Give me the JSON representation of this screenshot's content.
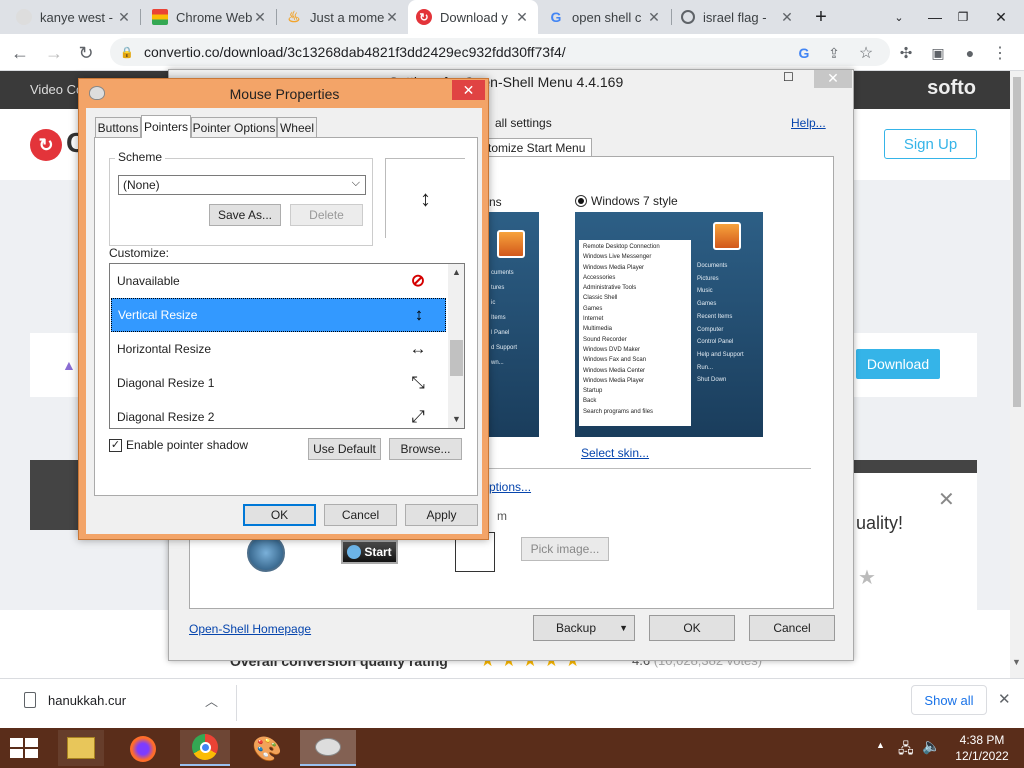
{
  "browser": {
    "tabs": [
      {
        "title": "kanye west -",
        "icon": "kanye-favicon-icon"
      },
      {
        "title": "Chrome Web",
        "icon": "chrome-web-store-icon"
      },
      {
        "title": "Just a mome",
        "icon": "cloudflare-flame-icon"
      },
      {
        "title": "Download y",
        "icon": "convertio-icon",
        "active": true
      },
      {
        "title": "open shell c",
        "icon": "google-g-icon"
      },
      {
        "title": "israel flag -",
        "icon": "globe-icon"
      }
    ],
    "url": "convertio.co/download/3c13268dab4821f3dd2429ec932fdd30ff73f4/"
  },
  "site": {
    "topbar_left": "Video Co",
    "topbar_brand": "softo",
    "logo_letter": "C",
    "signup": "Sign Up",
    "download": "Download",
    "promo_text": "uality!",
    "rating_label": "Overall conversion quality rating",
    "rating_value": "4.6",
    "rating_votes": "(10,028,382 votes)"
  },
  "openshell": {
    "title": "Settings for Open-Shell Menu 4.4.169",
    "all_settings": "all settings",
    "help": "Help...",
    "tab_label": "stomize Start Menu",
    "style_partial": "ns",
    "win7_label": "Windows 7 style",
    "select_skin": "Select skin...",
    "options_link": "ptions...",
    "m_label": "m",
    "start_label": "Start",
    "pick_image": "Pick image...",
    "homepage": "Open-Shell Homepage",
    "backup": "Backup",
    "ok": "OK",
    "cancel": "Cancel",
    "menu_items": [
      "Remote Desktop Connection",
      "Windows Live Messenger",
      "Windows Media Player",
      "Accessories",
      "Administrative Tools",
      "Classic Shell",
      "Games",
      "Internet",
      "Multimedia",
      "Sound Recorder",
      "Windows DVD Maker",
      "Windows Fax and Scan",
      "Windows Media Center",
      "Windows Media Player",
      "Startup",
      "Back",
      "Search programs and files"
    ],
    "right_items": [
      "Documents",
      "Pictures",
      "Music",
      "Games",
      "Recent Items",
      "Computer",
      "Control Panel",
      "Help and Support",
      "Run...",
      "Shut Down"
    ],
    "left_items": [
      "cuments",
      "tures",
      "ic",
      "Items",
      "l Panel",
      "d Support",
      "wn..."
    ]
  },
  "mouse": {
    "title": "Mouse Properties",
    "tabs": [
      "Buttons",
      "Pointers",
      "Pointer Options",
      "Wheel"
    ],
    "scheme_label": "Scheme",
    "scheme_value": "(None)",
    "save_as": "Save As...",
    "delete": "Delete",
    "customize": "Customize:",
    "list": [
      {
        "label": "Unavailable",
        "icon": "unavailable-cursor-icon"
      },
      {
        "label": "Vertical Resize",
        "icon": "vertical-resize-cursor-icon",
        "selected": true
      },
      {
        "label": "Horizontal Resize",
        "icon": "horizontal-resize-cursor-icon"
      },
      {
        "label": "Diagonal Resize 1",
        "icon": "diagonal-resize-1-cursor-icon"
      },
      {
        "label": "Diagonal Resize 2",
        "icon": "diagonal-resize-2-cursor-icon"
      }
    ],
    "shadow_label": "Enable pointer shadow",
    "shadow_checked": true,
    "use_default": "Use Default",
    "browse": "Browse...",
    "ok": "OK",
    "cancel": "Cancel",
    "apply": "Apply"
  },
  "downloads": {
    "file": "hanukkah.cur",
    "show_all": "Show all"
  },
  "taskbar": {
    "time": "4:38 PM",
    "date": "12/1/2022"
  }
}
